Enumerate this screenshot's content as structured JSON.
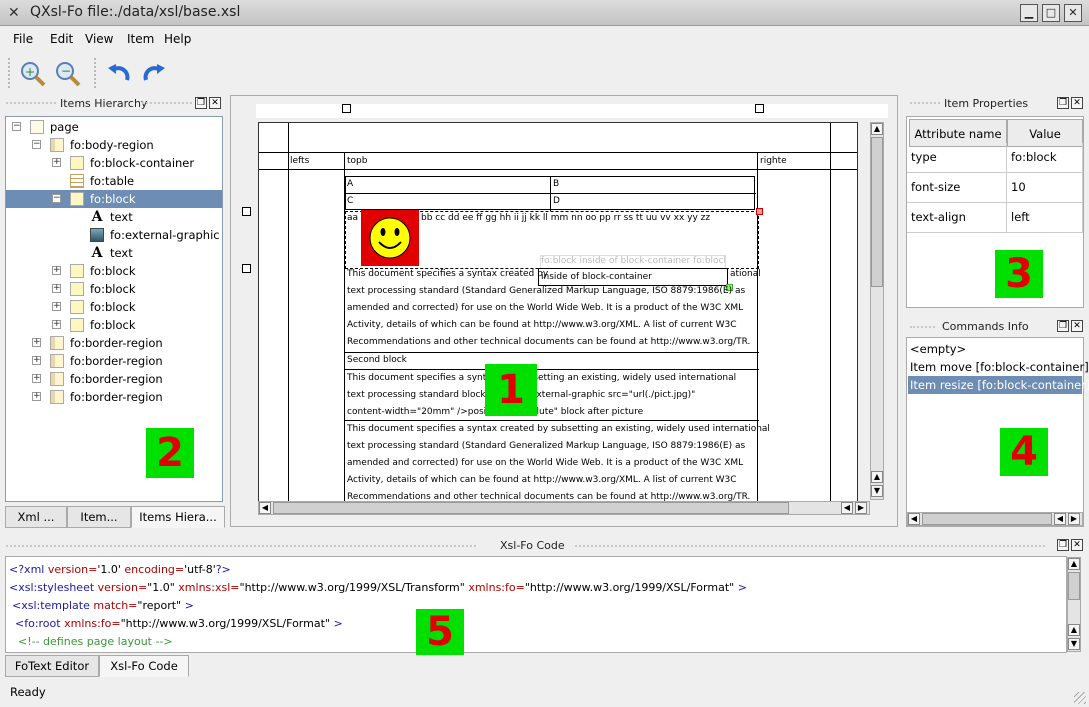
{
  "window": {
    "title": "QXsl-Fo file:./data/xsl/base.xsl",
    "buttons": [
      "▁",
      "□",
      "✕"
    ]
  },
  "menu": [
    "File",
    "Edit",
    "View",
    "Item",
    "Help"
  ],
  "toolbar": {
    "icons": [
      "zoom-in-icon",
      "zoom-out-icon",
      "undo-icon",
      "redo-icon"
    ]
  },
  "hierarchy": {
    "title": "Items Hierarchy",
    "items": [
      {
        "label": "page",
        "icon": "page",
        "expander": "−",
        "depth": 0
      },
      {
        "label": "fo:body-region",
        "icon": "region",
        "expander": "−",
        "depth": 1
      },
      {
        "label": "fo:block-container",
        "icon": "block",
        "expander": "+",
        "depth": 2
      },
      {
        "label": "fo:table",
        "icon": "table",
        "expander": "",
        "depth": 2
      },
      {
        "label": "fo:block",
        "icon": "block",
        "expander": "−",
        "depth": 2,
        "selected": true
      },
      {
        "label": "text",
        "icon": "text",
        "expander": "",
        "depth": 3
      },
      {
        "label": "fo:external-graphic",
        "icon": "img",
        "expander": "",
        "depth": 3
      },
      {
        "label": "text",
        "icon": "text",
        "expander": "",
        "depth": 3
      },
      {
        "label": "fo:block",
        "icon": "block",
        "expander": "+",
        "depth": 2
      },
      {
        "label": "fo:block",
        "icon": "block",
        "expander": "+",
        "depth": 2
      },
      {
        "label": "fo:block",
        "icon": "block",
        "expander": "+",
        "depth": 2
      },
      {
        "label": "fo:block",
        "icon": "block",
        "expander": "+",
        "depth": 2
      },
      {
        "label": "fo:border-region",
        "icon": "region",
        "expander": "+",
        "depth": 1
      },
      {
        "label": "fo:border-region",
        "icon": "region",
        "expander": "+",
        "depth": 1
      },
      {
        "label": "fo:border-region",
        "icon": "region",
        "expander": "+",
        "depth": 1
      },
      {
        "label": "fo:border-region",
        "icon": "region",
        "expander": "+",
        "depth": 1
      }
    ],
    "tabs": [
      "Xml ...",
      "Item...",
      "Items Hiera..."
    ]
  },
  "labels": {
    "n1": "1",
    "n2": "2",
    "n3": "3",
    "n4": "4",
    "n5": "5"
  },
  "doc": {
    "lefts": "lefts",
    "topb": "topb",
    "righte": "righte",
    "table": [
      "A",
      "B",
      "C",
      "D"
    ],
    "aa": "aa",
    "alphabet": "bb cc dd ee ff gg hh ii jj kk ll mm nn oo pp rr ss tt uu vv xx yy zz",
    "ghost": "fo:block inside of block-container fo:block",
    "inside": "inside of block-container",
    "para1": [
      "This document specifies a syntax created by",
      "ational",
      "text processing standard (Standard Generalized Markup Language, ISO 8879:1986(E) as",
      "amended and corrected) for use on the World Wide Web. It is a product of the W3C XML",
      "Activity, details of which can be found at http://www.w3.org/XML. A list of current W3C",
      "Recommendations and other technical documents can be found at http://www.w3.org/TR."
    ],
    "second": "Second block",
    "para2": [
      "This document specifies a synta",
      "y subsetting an existing, widely used international",
      "text processing standard block b",
      "e fo:external-graphic src=\"url(./pict.jpg)\"",
      "content-width=\"20mm\" />position=\"absolute\" block after picture"
    ],
    "para3": [
      "This document specifies a syntax created by subsetting an existing, widely used international",
      "text processing standard (Standard Generalized Markup Language, ISO 8879:1986(E) as",
      "amended and corrected) for use on the World Wide Web. It is a product of the W3C XML",
      "Activity, details of which can be found at http://www.w3.org/XML. A list of current W3C",
      "Recommendations and other technical documents can be found at http://www.w3.org/TR."
    ]
  },
  "properties": {
    "title": "Item Properties",
    "header": [
      "Attribute name",
      "Value"
    ],
    "rows": [
      [
        "type",
        "fo:block"
      ],
      [
        "font-size",
        "10"
      ],
      [
        "text-align",
        "left"
      ]
    ]
  },
  "commands": {
    "title": "Commands Info",
    "items": [
      "<empty>",
      "Item move [fo:block-container]",
      "Item resize [fo:block-container]"
    ]
  },
  "code": {
    "title": "Xsl-Fo Code",
    "tabs": [
      "FoText Editor",
      "Xsl-Fo Code"
    ]
  },
  "status": "Ready"
}
